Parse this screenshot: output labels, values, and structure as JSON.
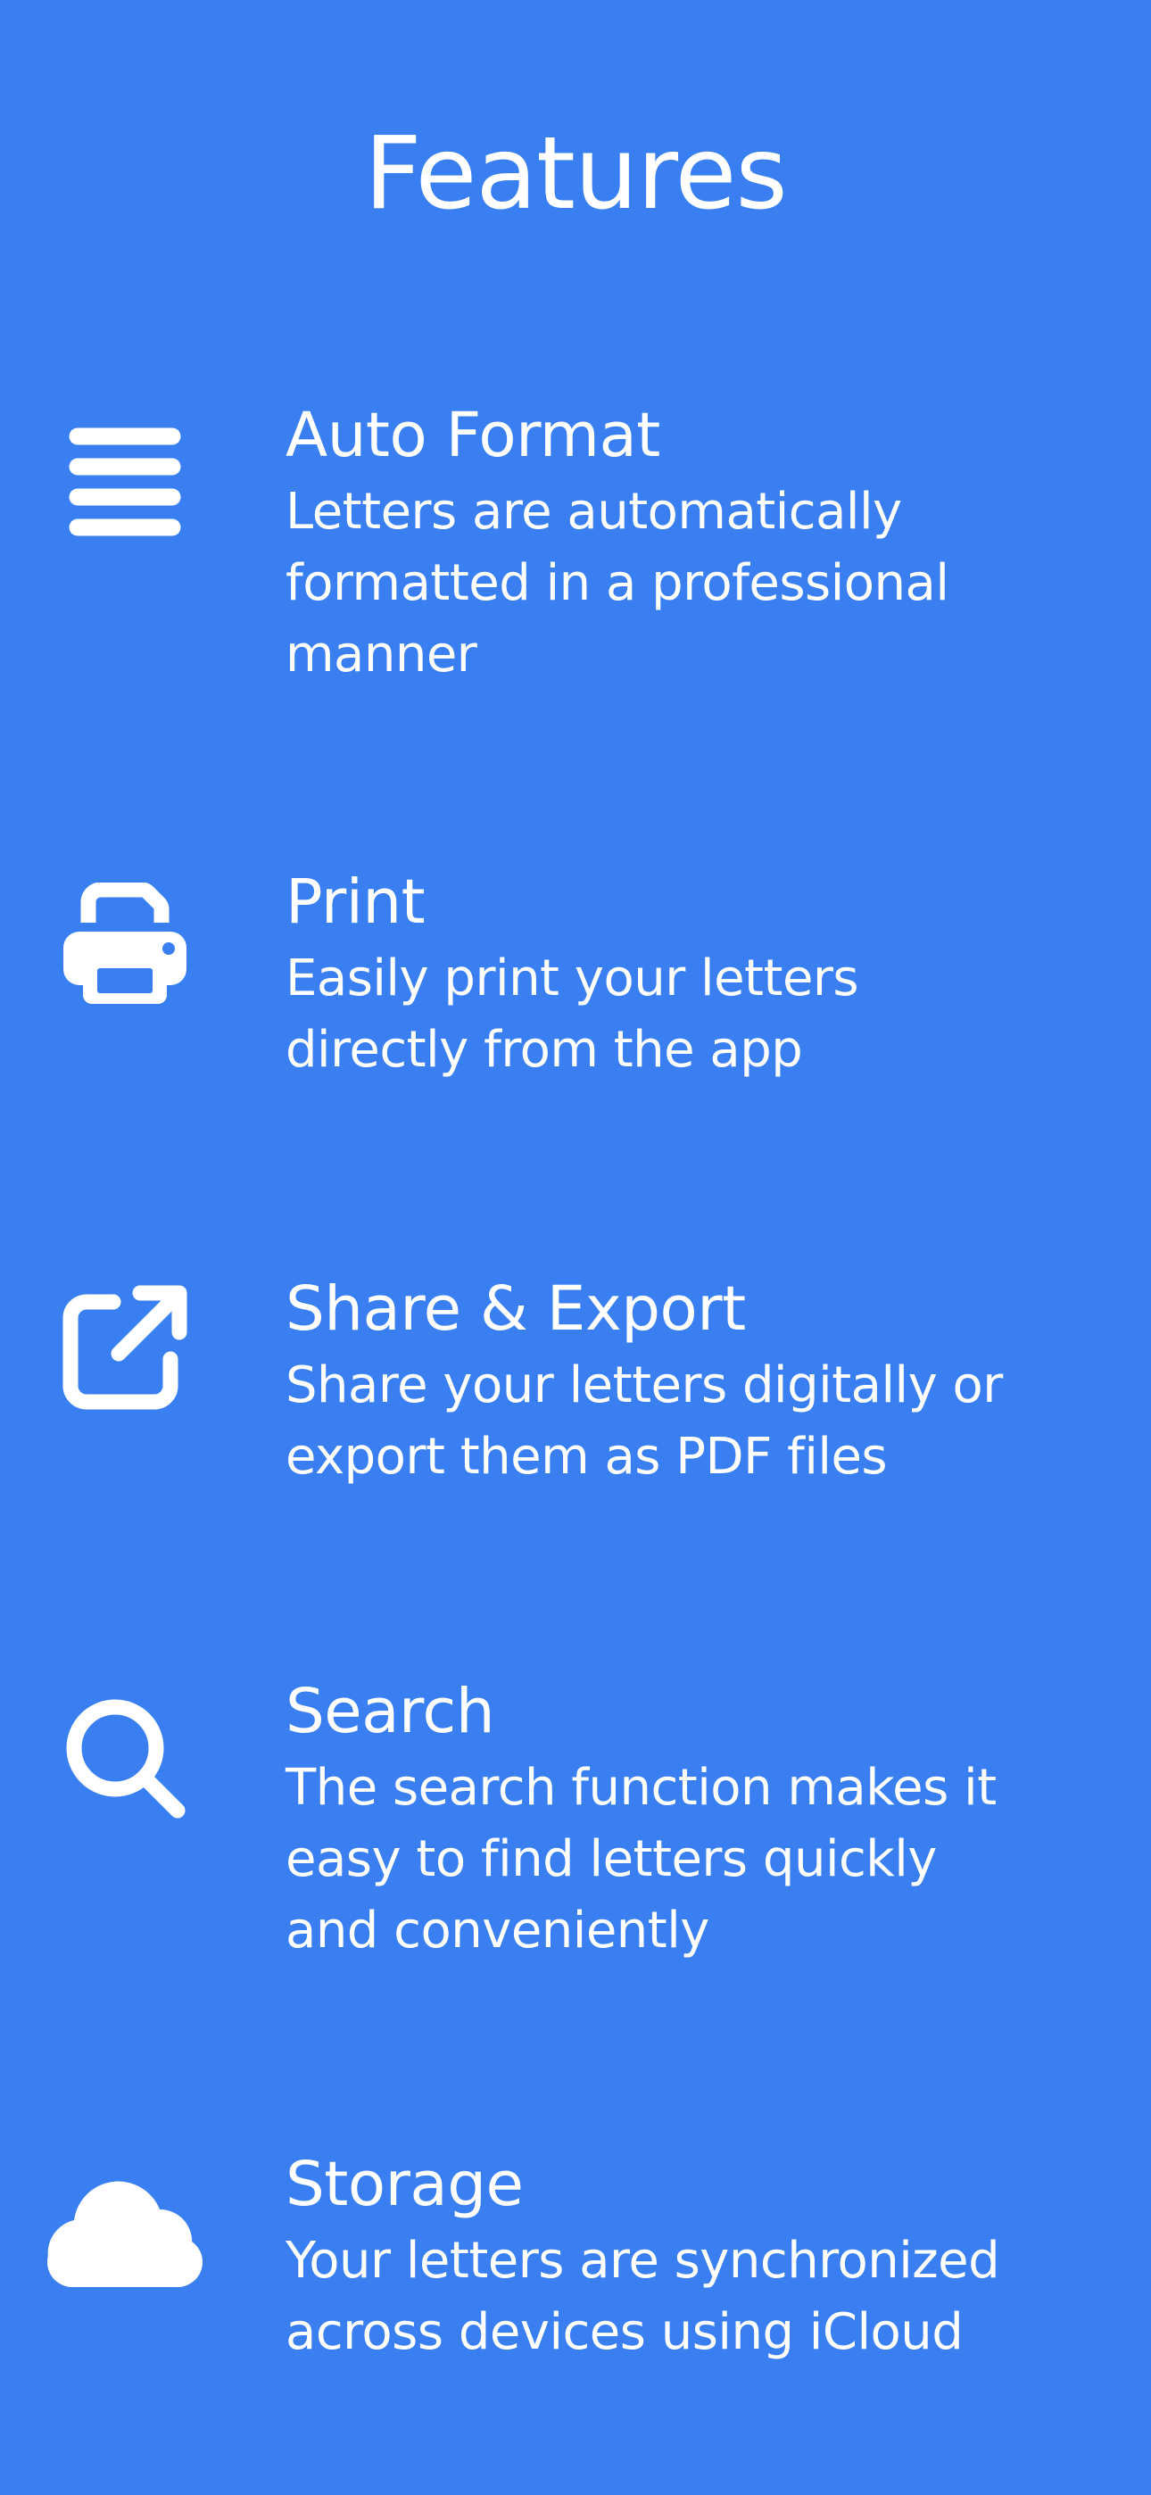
{
  "page": {
    "title": "Features",
    "background_color": "#3A7FF2",
    "text_color": "#FFFFFF"
  },
  "features": [
    {
      "icon": "lines-icon",
      "title": "Auto Format",
      "desc_lines": [
        "Letters are automatically",
        "formatted in a professional",
        "manner"
      ]
    },
    {
      "icon": "printer-icon",
      "title": "Print",
      "desc_lines": [
        "Easily print your letters",
        "directly from the app"
      ]
    },
    {
      "icon": "share-export-icon",
      "title": "Share & Export",
      "desc_lines": [
        "Share your letters digitally or",
        "export them as PDF files"
      ]
    },
    {
      "icon": "search-icon",
      "title": "Search",
      "desc_lines": [
        "The search function makes it",
        "easy to find letters quickly",
        "and conveniently"
      ]
    },
    {
      "icon": "cloud-icon",
      "title": "Storage",
      "desc_lines": [
        "Your letters are synchronized",
        "across devices using iCloud"
      ]
    }
  ]
}
